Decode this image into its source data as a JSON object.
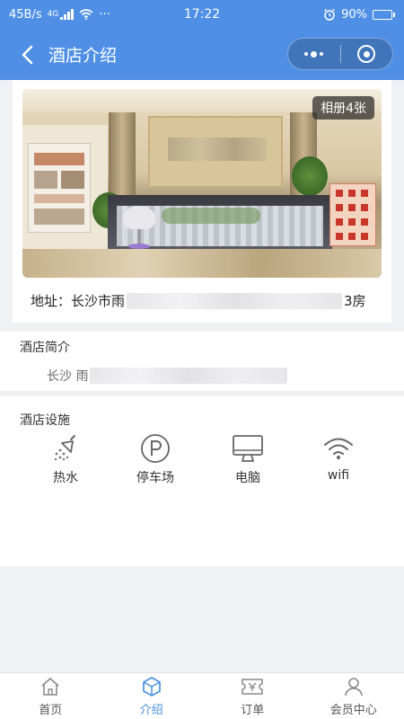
{
  "status_bar": {
    "speed": "45B/s",
    "network": "4G",
    "more": "···",
    "time": "17:22",
    "battery": "90%",
    "battery_level": 0.9
  },
  "nav": {
    "title": "酒店介绍",
    "back_icon": "chevron-left-icon",
    "menu_icon": "more-dots-icon",
    "close_icon": "target-icon"
  },
  "hotel": {
    "album_label": "相册4张",
    "address_prefix": "地址：长沙市雨",
    "address_suffix": "3房"
  },
  "intro": {
    "title": "酒店简介",
    "text_prefix": "长沙 雨"
  },
  "facilities": {
    "title": "酒店设施",
    "items": [
      {
        "label": "热水",
        "icon": "shower-icon"
      },
      {
        "label": "停车场",
        "icon": "parking-icon"
      },
      {
        "label": "电脑",
        "icon": "computer-icon"
      },
      {
        "label": "wifi",
        "icon": "wifi-icon"
      }
    ]
  },
  "tabbar": {
    "active_color": "#4a90e2",
    "items": [
      {
        "label": "首页",
        "icon": "home-icon",
        "active": false
      },
      {
        "label": "介绍",
        "icon": "cube-icon",
        "active": true
      },
      {
        "label": "订单",
        "icon": "ticket-icon",
        "active": false
      },
      {
        "label": "会员中心",
        "icon": "user-icon",
        "active": false
      }
    ]
  },
  "colors": {
    "header": "#4f8fe6",
    "accent": "#4a90e2",
    "background": "#f0f1f5"
  }
}
